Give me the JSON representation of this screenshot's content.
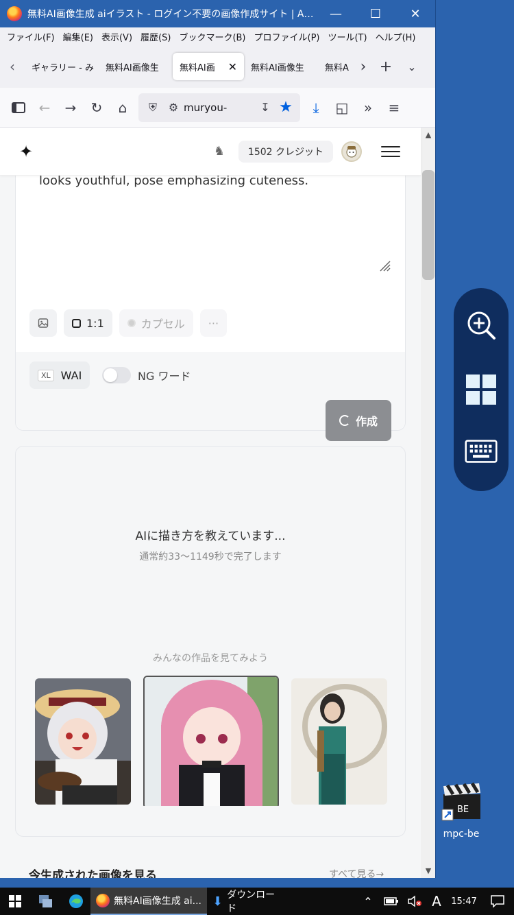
{
  "window": {
    "title": "無料AI画像生成 aiイラスト - ログイン不要の画像作成サイト | AIGA..."
  },
  "menu": [
    "ファイル(F)",
    "編集(E)",
    "表示(V)",
    "履歴(S)",
    "ブックマーク(B)",
    "プロファイル(P)",
    "ツール(T)",
    "ヘルプ(H)"
  ],
  "tabs": [
    {
      "label": "ギャラリー - み"
    },
    {
      "label": "無料AI画像生"
    },
    {
      "label": "無料AI画",
      "active": true
    },
    {
      "label": "無料AI画像生"
    },
    {
      "label": "無料A"
    }
  ],
  "address": {
    "url": "muryou-"
  },
  "site": {
    "credits": "1502 クレジット"
  },
  "form": {
    "prompt_text": "looks youthful, pose emphasizing cuteness.",
    "ratio": "1:1",
    "capsule": "カプセル",
    "more": "···",
    "wai_badge": "XL",
    "wai_label": "WAI",
    "ng_label": "NG ワード",
    "ng_enabled": false,
    "create_label": "作成"
  },
  "progress": {
    "status": "AIに描き方を教えています...",
    "substatus": "通常約33〜1149秒で完了します"
  },
  "gallery": {
    "title": "みんなの作品を見てみよう"
  },
  "recent": {
    "title": "今生成された画像を見る",
    "see_all": "すべて見る→"
  },
  "desktop": {
    "icon_label": "mpc-be",
    "clap_text": "BE"
  },
  "taskbar": {
    "firefox_label": "無料AI画像生成 ai...",
    "download_label": "ダウンロード",
    "ime": "A",
    "time": "15:47"
  }
}
